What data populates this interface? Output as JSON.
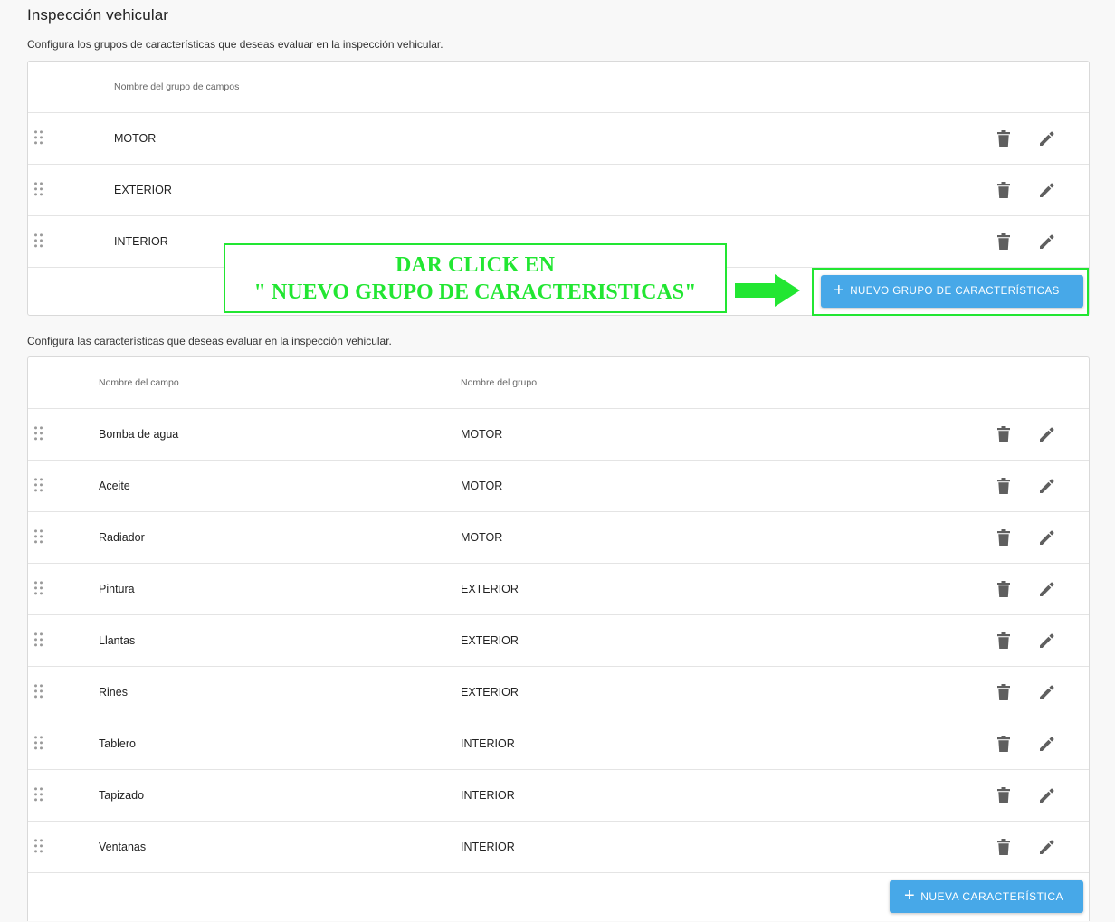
{
  "page": {
    "title": "Inspección vehicular",
    "groups_description": "Configura los grupos de características que deseas evaluar en la inspección vehicular.",
    "fields_description": "Configura las características que deseas evaluar en la inspección vehicular."
  },
  "groups_table": {
    "header": "Nombre del grupo de campos",
    "rows": [
      "MOTOR",
      "EXTERIOR",
      "INTERIOR"
    ],
    "add_button_label": "NUEVO GRUPO DE CARACTERÍSTICAS"
  },
  "fields_table": {
    "headers": {
      "field": "Nombre del campo",
      "group": "Nombre del grupo"
    },
    "rows": [
      {
        "field": "Bomba de agua",
        "group": "MOTOR"
      },
      {
        "field": "Aceite",
        "group": "MOTOR"
      },
      {
        "field": "Radiador",
        "group": "MOTOR"
      },
      {
        "field": "Pintura",
        "group": "EXTERIOR"
      },
      {
        "field": "Llantas",
        "group": "EXTERIOR"
      },
      {
        "field": "Rines",
        "group": "EXTERIOR"
      },
      {
        "field": "Tablero",
        "group": "INTERIOR"
      },
      {
        "field": "Tapizado",
        "group": "INTERIOR"
      },
      {
        "field": "Ventanas",
        "group": "INTERIOR"
      }
    ],
    "add_button_label": "NUEVA CARACTERÍSTICA"
  },
  "annotation": {
    "line1": "DAR CLICK EN",
    "line2": "\" NUEVO GRUPO DE CARACTERISTICAS\""
  },
  "icons": {
    "drag": "drag-handle-icon",
    "delete": "trash-icon",
    "edit": "pencil-icon",
    "add": "plus-icon"
  },
  "colors": {
    "primary_button": "#47a8e8",
    "annotation": "#22e632",
    "icon": "#5f5f5f"
  }
}
